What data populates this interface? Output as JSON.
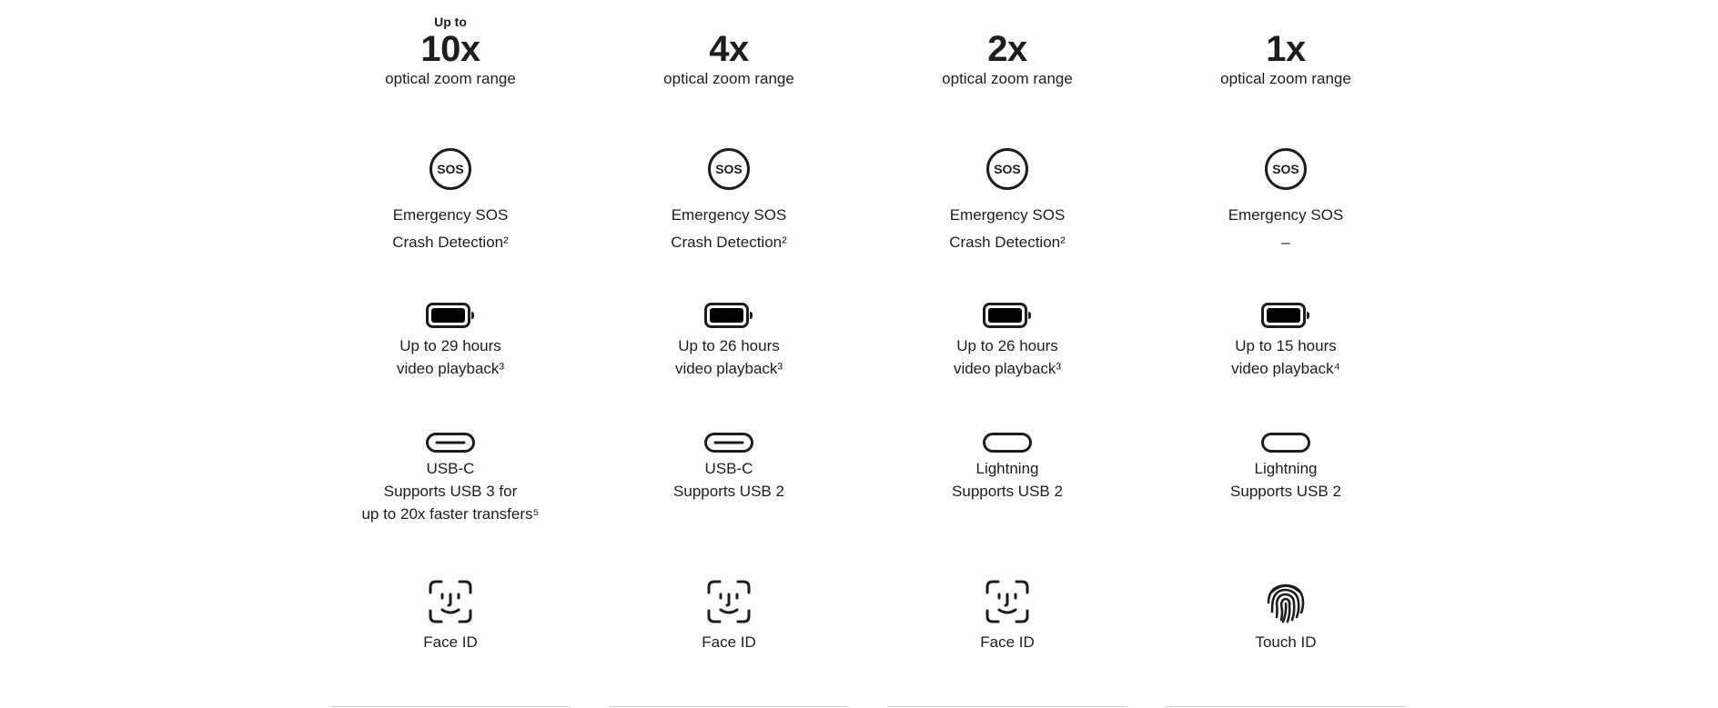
{
  "models": [
    {
      "zoom_prefix": "Up to",
      "zoom_value": "10x",
      "zoom_caption": "optical zoom range",
      "safety_icon": "sos-icon",
      "safety_line1": "Emergency SOS",
      "safety_line2": "Crash Detection²",
      "battery_icon": "battery-icon",
      "battery_line1": "Up to 29 hours",
      "battery_line2": "video playback³",
      "port_icon": "usb-c-port-icon",
      "port_line1": "USB-C",
      "port_line2": "Supports USB 3 for",
      "port_line3": "up to 20x faster transfers⁵",
      "auth_icon": "face-id-icon",
      "auth_label": "Face ID"
    },
    {
      "zoom_prefix": "",
      "zoom_value": "4x",
      "zoom_caption": "optical zoom range",
      "safety_icon": "sos-icon",
      "safety_line1": "Emergency SOS",
      "safety_line2": "Crash Detection²",
      "battery_icon": "battery-icon",
      "battery_line1": "Up to 26 hours",
      "battery_line2": "video playback³",
      "port_icon": "usb-c-port-icon",
      "port_line1": "USB-C",
      "port_line2": "Supports USB 2",
      "port_line3": "",
      "auth_icon": "face-id-icon",
      "auth_label": "Face ID"
    },
    {
      "zoom_prefix": "",
      "zoom_value": "2x",
      "zoom_caption": "optical zoom range",
      "safety_icon": "sos-icon",
      "safety_line1": "Emergency SOS",
      "safety_line2": "Crash Detection²",
      "battery_icon": "battery-icon",
      "battery_line1": "Up to 26 hours",
      "battery_line2": "video playback³",
      "port_icon": "lightning-port-icon",
      "port_line1": "Lightning",
      "port_line2": "Supports USB 2",
      "port_line3": "",
      "auth_icon": "face-id-icon",
      "auth_label": "Face ID"
    },
    {
      "zoom_prefix": "",
      "zoom_value": "1x",
      "zoom_caption": "optical zoom range",
      "safety_icon": "sos-icon",
      "safety_line1": "Emergency SOS",
      "safety_line2": "–",
      "battery_icon": "battery-icon",
      "battery_line1": "Up to 15 hours",
      "battery_line2": "video playback⁴",
      "port_icon": "lightning-port-icon",
      "port_line1": "Lightning",
      "port_line2": "Supports USB 2",
      "port_line3": "",
      "auth_icon": "touch-id-icon",
      "auth_label": "Touch ID"
    }
  ],
  "sos_icon_text": "SOS",
  "colors": {
    "text": "#1d1d1f",
    "divider": "#d2d2d7",
    "background": "#ffffff"
  }
}
